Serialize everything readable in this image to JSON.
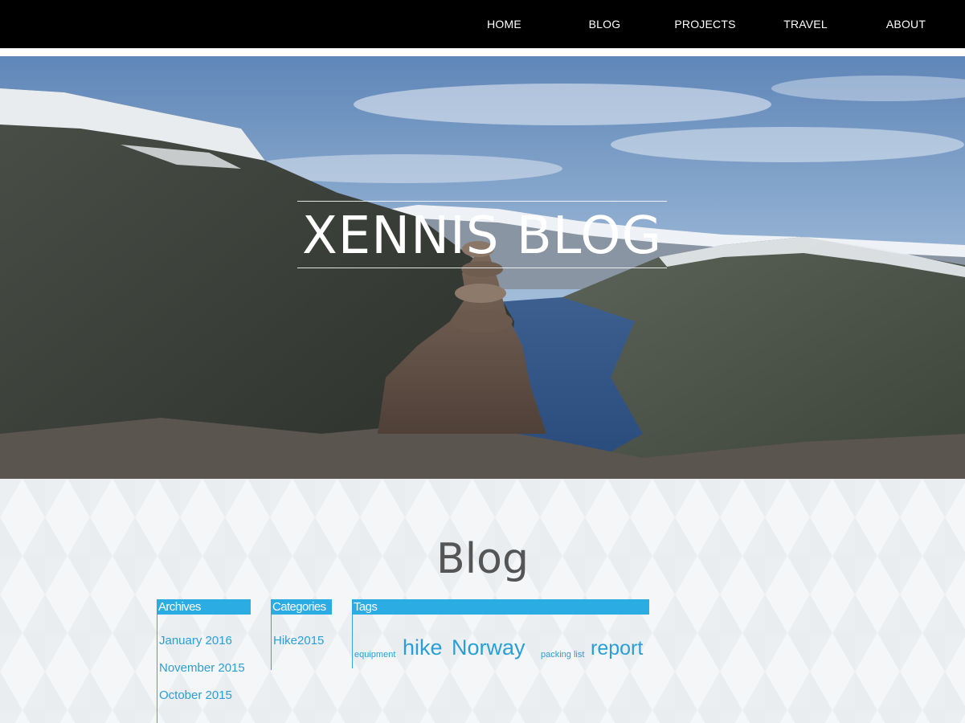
{
  "nav": {
    "items": [
      "HOME",
      "BLOG",
      "PROJECTS",
      "TRAVEL",
      "ABOUT"
    ]
  },
  "hero": {
    "title": "XENNIS BLOG"
  },
  "main": {
    "heading": "Blog"
  },
  "archives": {
    "title": "Archives",
    "items": [
      "January 2016",
      "November 2015",
      "October 2015"
    ]
  },
  "categories": {
    "title": "Categories",
    "items": [
      "Hike2015"
    ]
  },
  "tags": {
    "title": "Tags",
    "items": [
      "equipment",
      "hike",
      "Norway",
      "packing list",
      "report"
    ]
  },
  "colors": {
    "nav_bg": "#000000",
    "accent": "#2bace2",
    "link": "#2a9fd6"
  }
}
